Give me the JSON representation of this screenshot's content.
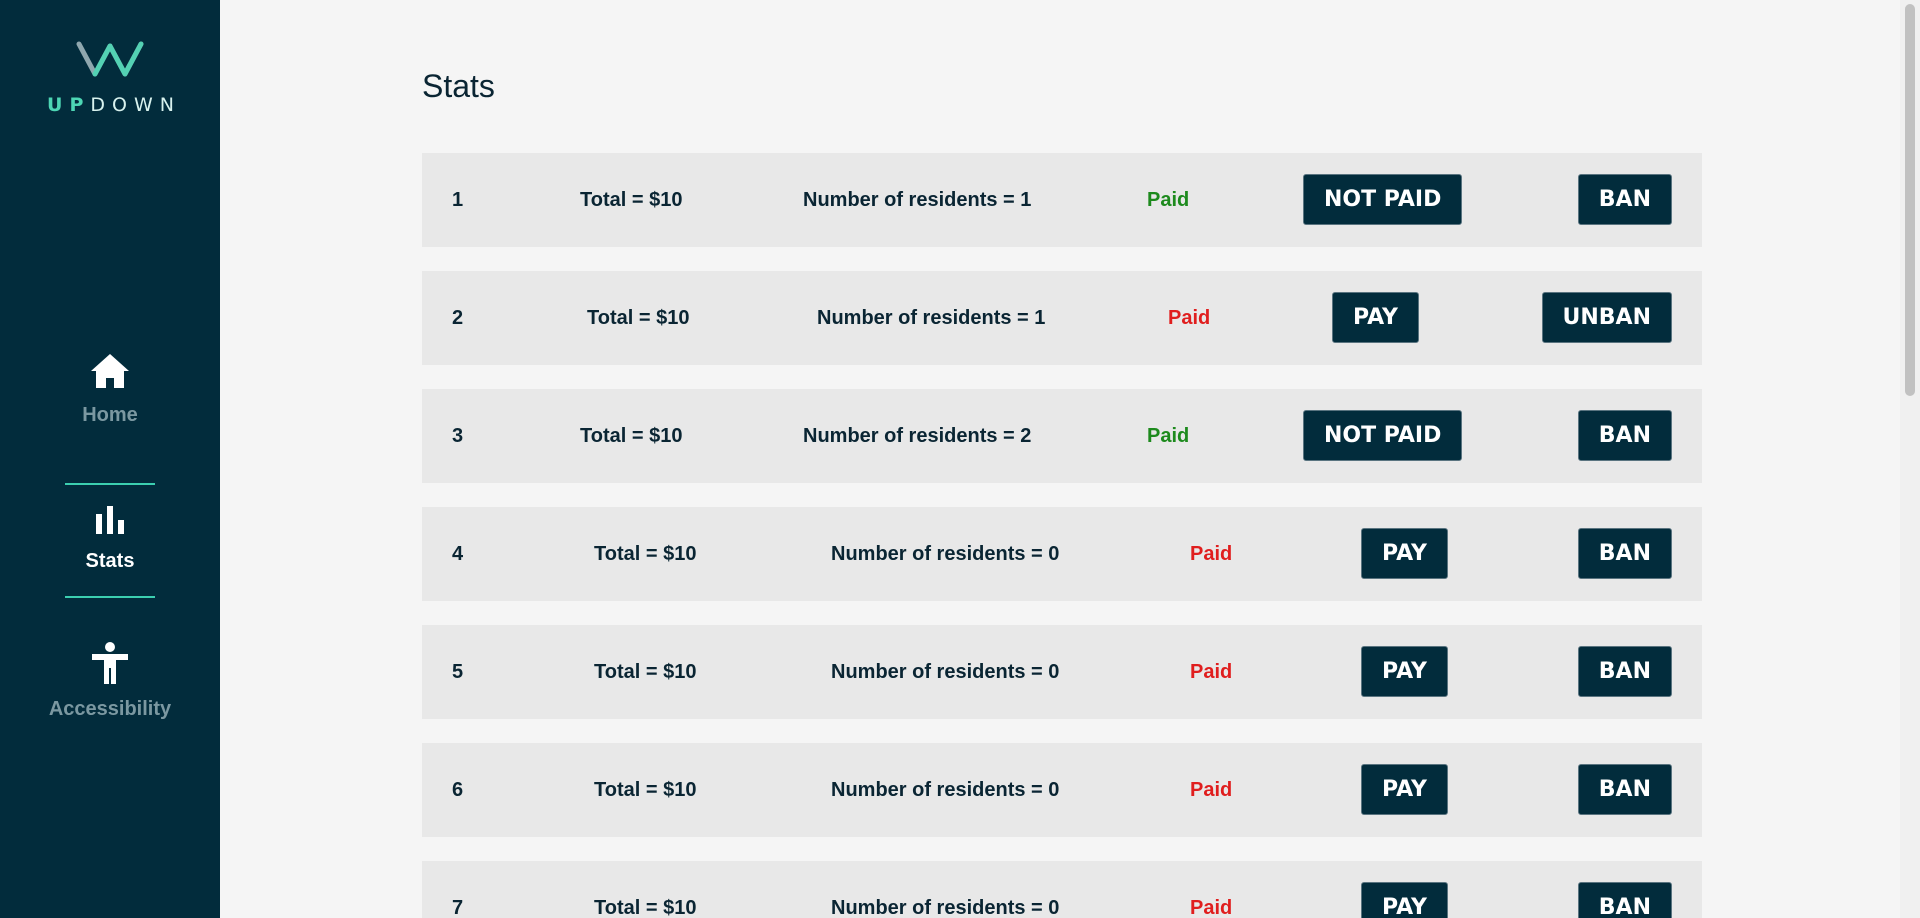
{
  "brand": {
    "part1": "UP",
    "part2": "DOWN",
    "accent_color": "#4dd6b4"
  },
  "nav": [
    {
      "label": "Home",
      "icon": "home-icon",
      "active": false
    },
    {
      "label": "Stats",
      "icon": "bar-chart-icon",
      "active": true
    },
    {
      "label": "Accessibility",
      "icon": "accessibility-icon",
      "active": false
    }
  ],
  "page_title": "Stats",
  "colors": {
    "sidebar": "#022c3c",
    "paid_green": "#1d8a1d",
    "unpaid_red": "#e01e1e",
    "button": "#022c3c"
  },
  "rows": [
    {
      "id": "1",
      "total": "Total = $10",
      "residents": "Number of residents = 1",
      "status": "Paid",
      "paid": true,
      "pay_action": "NOT PAID",
      "ban_action": "BAN"
    },
    {
      "id": "2",
      "total": "Total = $10",
      "residents": "Number of residents = 1",
      "status": "Paid",
      "paid": false,
      "pay_action": "PAY",
      "ban_action": "UNBAN"
    },
    {
      "id": "3",
      "total": "Total = $10",
      "residents": "Number of residents = 2",
      "status": "Paid",
      "paid": true,
      "pay_action": "NOT PAID",
      "ban_action": "BAN"
    },
    {
      "id": "4",
      "total": "Total = $10",
      "residents": "Number of residents = 0",
      "status": "Paid",
      "paid": false,
      "pay_action": "PAY",
      "ban_action": "BAN"
    },
    {
      "id": "5",
      "total": "Total = $10",
      "residents": "Number of residents = 0",
      "status": "Paid",
      "paid": false,
      "pay_action": "PAY",
      "ban_action": "BAN"
    },
    {
      "id": "6",
      "total": "Total = $10",
      "residents": "Number of residents = 0",
      "status": "Paid",
      "paid": false,
      "pay_action": "PAY",
      "ban_action": "BAN"
    },
    {
      "id": "7",
      "total": "Total = $10",
      "residents": "Number of residents = 0",
      "status": "Paid",
      "paid": false,
      "pay_action": "PAY",
      "ban_action": "BAN"
    }
  ]
}
